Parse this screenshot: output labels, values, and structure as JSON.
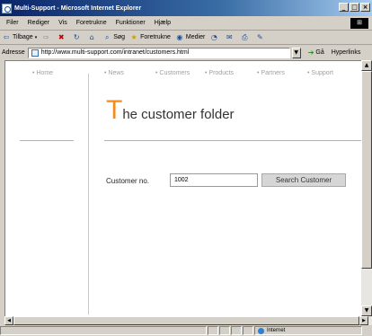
{
  "window": {
    "title": "Multi-Support - Microsoft Internet Explorer",
    "minimize": "_",
    "maximize": "□",
    "close": "×"
  },
  "menu": [
    "Filer",
    "Rediger",
    "Vis",
    "Foretrukne",
    "Funktioner",
    "Hjælp"
  ],
  "toolbar": {
    "back": "Tilbage",
    "search": "Søg",
    "favorites": "Foretrukne",
    "media": "Medier"
  },
  "address": {
    "label": "Adresse",
    "url": "http://www.multi-support.com/intranet/customers.html",
    "go": "Gå",
    "links": "Hyperlinks"
  },
  "nav": [
    "Home",
    "News",
    "Customers",
    "Products",
    "Partners",
    "Support"
  ],
  "page": {
    "title_initial": "T",
    "title_rest": "he customer folder",
    "customer_label": "Customer no.",
    "customer_value": "1002",
    "search_button": "Search Customer"
  },
  "status": {
    "zone": "Internet"
  },
  "colors": {
    "accent": "#f28c1e",
    "titlebar": "#0a246a"
  }
}
